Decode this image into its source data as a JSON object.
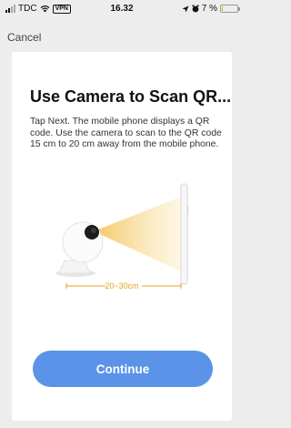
{
  "status_bar": {
    "carrier": "TDC",
    "vpn": "VPN",
    "time": "16.32",
    "battery_text": "7 %",
    "battery_level": 0.07
  },
  "nav": {
    "cancel_label": "Cancel"
  },
  "card": {
    "title": "Use Camera to Scan QR...",
    "description": "Tap Next. The mobile phone displays a QR code. Use the camera to scan to the QR code 15 cm to 20 cm away from the mobile phone.",
    "distance_label": "20~30cm",
    "continue_label": "Continue"
  },
  "colors": {
    "accent": "#5b93e8",
    "beam": "#f5c45a",
    "distance": "#e6a11f"
  }
}
